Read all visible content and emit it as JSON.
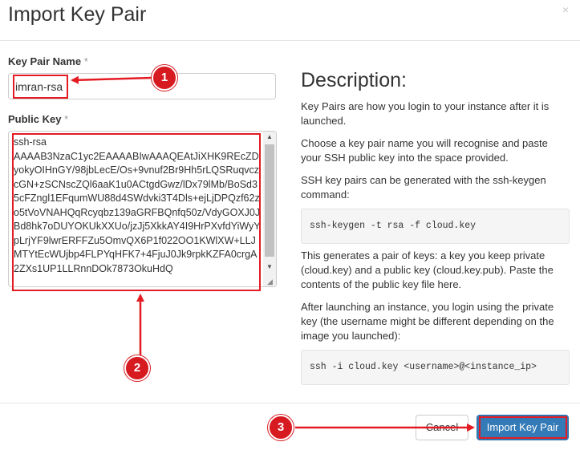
{
  "dialog": {
    "title": "Import Key Pair",
    "close_glyph": "×"
  },
  "form": {
    "name_label": "Key Pair Name",
    "name_required": "*",
    "name_value": "imran-rsa",
    "public_key_label": "Public Key",
    "public_key_required": "*",
    "public_key_value": "ssh-rsa\nAAAAB3NzaC1yc2EAAAABIwAAAQEAtJiXHK9REcZDyokyOIHnGY/98jbLecE/Os+9vnuf2Br9Hh5rLQSRuqvczcGN+zSCNscZQl6aaK1u0ACtgdGwz/lDx79lMb/BoSd35cFZngl1EFqumWU88d4SWdvki3T4Dls+ejLjDPQzf62zo5tVoVNAHQqRcyqbz139aGRFBQnfq50z/VdyGOXJ0JBd8hk7oDUYOKUkXXUo/jzJj5XkkAY4I9HrPXvfdYiWyYpLrjYF9lwrERFFZu5OmvQX6P1f022OO1KWlXW+LLJMTYtEcWUjbp4FLPYqHFK7+4FjuJ0Jk9rpkKZFA0crgA2ZXs1UP1LLRnnDOk7873OkuHdQ"
  },
  "description": {
    "heading": "Description:",
    "p1": "Key Pairs are how you login to your instance after it is launched.",
    "p2": "Choose a key pair name you will recognise and paste your SSH public key into the space provided.",
    "p3": "SSH key pairs can be generated with the ssh-keygen command:",
    "code1": "ssh-keygen -t rsa -f cloud.key",
    "p4": "This generates a pair of keys: a key you keep private (cloud.key) and a public key (cloud.key.pub). Paste the contents of the public key file here.",
    "p5": "After launching an instance, you login using the private key (the username might be different depending on the image you launched):",
    "code2": "ssh -i cloud.key <username>@<instance_ip>"
  },
  "footer": {
    "cancel_label": "Cancel",
    "import_label": "Import Key Pair"
  },
  "annotations": {
    "badge1": "1",
    "badge2": "2",
    "badge3": "3",
    "color": "#e31b23"
  },
  "icons": {
    "close": "close-icon",
    "scroll_up": "scroll-up-icon",
    "scroll_down": "scroll-down-icon",
    "resize": "resize-grip-icon"
  }
}
